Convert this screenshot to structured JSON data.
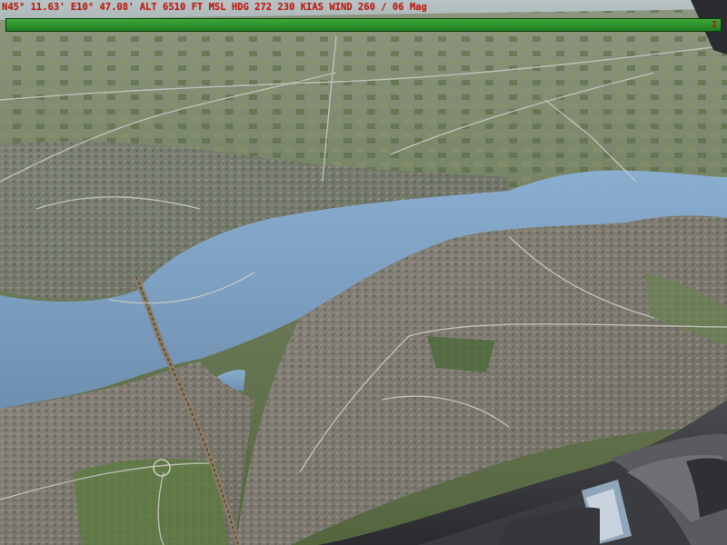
{
  "hud": {
    "text": "N45° 11.63' E10° 47.08' ALT 6510 FT MSL HDG 272 230 KIAS WIND 260 / 06 Mag",
    "color": "#d11a12"
  },
  "status_bar": {
    "color": "#2f9a2c",
    "marker": "I"
  },
  "scene": {
    "water_color": "#7d9dbd",
    "land_color": "#5f7052",
    "city_color": "#8a8680",
    "cockpit_color": "#3a3b3e"
  }
}
